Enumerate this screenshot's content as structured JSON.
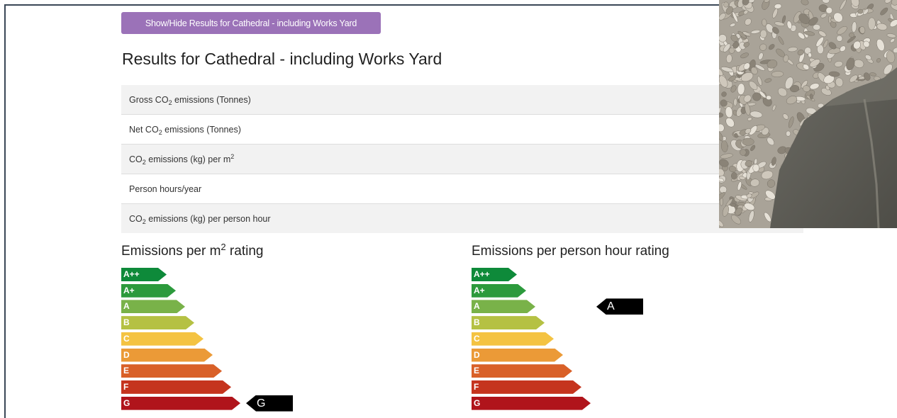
{
  "toggle_button": {
    "label": "Show/Hide Results for Cathedral - including Works Yard"
  },
  "results": {
    "title": "Results for Cathedral - including Works Yard",
    "rows": [
      {
        "pre": "Gross CO",
        "sub": "2",
        "post": " emissions (Tonnes)",
        "sup": ""
      },
      {
        "pre": "Net CO",
        "sub": "2",
        "post": " emissions (Tonnes)",
        "sup": ""
      },
      {
        "pre": "CO",
        "sub": "2",
        "post": " emissions (kg) per m",
        "sup": "2"
      },
      {
        "pre": "Person hours/year",
        "sub": "",
        "post": "",
        "sup": ""
      },
      {
        "pre": "CO",
        "sub": "2",
        "post": " emissions (kg) per person hour",
        "sup": ""
      }
    ]
  },
  "rating_m2": {
    "title_pre": "Emissions per m",
    "title_sup": "2",
    "title_post": " rating",
    "selected": "G"
  },
  "rating_person_hour": {
    "title": "Emissions per person hour rating",
    "selected": "A"
  },
  "bands": [
    {
      "label": "A++",
      "color": "#0e8a3a"
    },
    {
      "label": "A+",
      "color": "#2c9a3c"
    },
    {
      "label": "A",
      "color": "#79b249"
    },
    {
      "label": "B",
      "color": "#b5c143"
    },
    {
      "label": "C",
      "color": "#f4c342"
    },
    {
      "label": "D",
      "color": "#eb9a37"
    },
    {
      "label": "E",
      "color": "#d96028"
    },
    {
      "label": "F",
      "color": "#c5341e"
    },
    {
      "label": "G",
      "color": "#b0141b"
    }
  ],
  "colors": {
    "button_purple": "#9b72b8",
    "pointer_black": "#000000",
    "table_stripe": "#f2f2f2"
  },
  "photo": {
    "subject": "gravel-and-stone-photo"
  }
}
